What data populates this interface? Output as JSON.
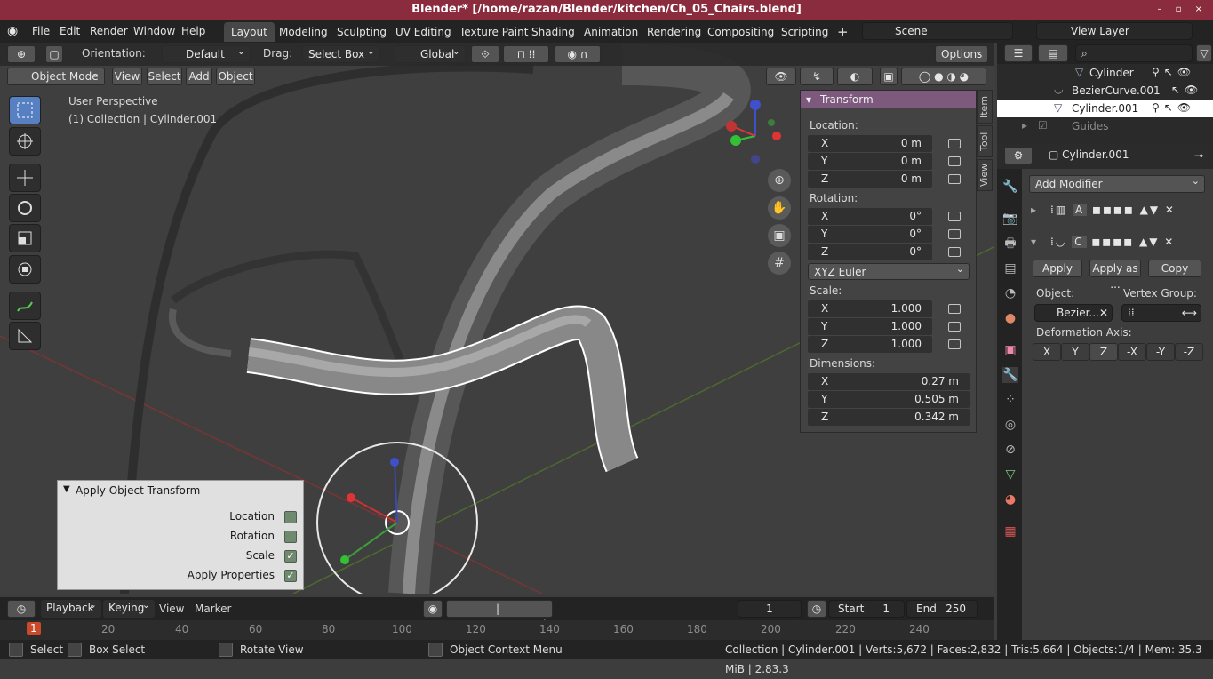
{
  "title": "Blender* [/home/razan/Blender/kitchen/Ch_05_Chairs.blend]",
  "menu": [
    "File",
    "Edit",
    "Render",
    "Window",
    "Help"
  ],
  "workspaces": [
    "Layout",
    "Modeling",
    "Sculpting",
    "UV Editing",
    "Texture Paint",
    "Shading",
    "Animation",
    "Rendering",
    "Compositing",
    "Scripting"
  ],
  "scene": "Scene",
  "viewlayer": "View Layer",
  "header": {
    "orientation_label": "Orientation:",
    "orientation": "Default",
    "drag_label": "Drag:",
    "drag": "Select Box",
    "transform": "Global",
    "options": "Options"
  },
  "vpheader": {
    "mode": "Object Mode",
    "view": "View",
    "select": "Select",
    "add": "Add",
    "object": "Object"
  },
  "overlay": {
    "perspective": "User Perspective",
    "collection": "(1) Collection | Cylinder.001"
  },
  "npanel": {
    "title": "Transform",
    "location": "Location:",
    "rotation": "Rotation:",
    "scale": "Scale:",
    "dimensions": "Dimensions:",
    "loc": [
      "0 m",
      "0 m",
      "0 m"
    ],
    "rot": [
      "0°",
      "0°",
      "0°"
    ],
    "rotmode": "XYZ Euler",
    "scl": [
      "1.000",
      "1.000",
      "1.000"
    ],
    "dim": [
      "0.27 m",
      "0.505 m",
      "0.342 m"
    ],
    "axes": [
      "X",
      "Y",
      "Z"
    ]
  },
  "vtabs": [
    "Item",
    "Tool",
    "View"
  ],
  "apply": {
    "title": "Apply Object Transform",
    "location": "Location",
    "rotation": "Rotation",
    "scale": "Scale",
    "props": "Apply Properties",
    "states": [
      false,
      false,
      true,
      true
    ]
  },
  "outliner": {
    "items": [
      "Cylinder",
      "BezierCurve.001",
      "Cylinder.001",
      "Guides"
    ]
  },
  "props": {
    "object": "Cylinder.001",
    "add_modifier": "Add Modifier",
    "apply": "Apply",
    "apply_as": "Apply as ...",
    "copy": "Copy",
    "object_label": "Object:",
    "vgroup_label": "Vertex Group:",
    "object_value": "Bezier...",
    "deform": "Deformation Axis:",
    "axes": [
      "X",
      "Y",
      "Z",
      "-X",
      "-Y",
      "-Z"
    ]
  },
  "timeline": {
    "playback": "Playback",
    "keying": "Keying",
    "view": "View",
    "marker": "Marker",
    "frame": "1",
    "start_label": "Start",
    "start": "1",
    "end_label": "End",
    "end": "250",
    "ticks": [
      "20",
      "40",
      "60",
      "80",
      "100",
      "120",
      "140",
      "160",
      "180",
      "200",
      "220",
      "240"
    ],
    "current": "1"
  },
  "status": {
    "select": "Select",
    "boxselect": "Box Select",
    "rotate": "Rotate View",
    "context": "Object Context Menu",
    "info": "Collection | Cylinder.001 | Verts:5,672 | Faces:2,832 | Tris:5,664 | Objects:1/4 | Mem: 35.3 MiB | 2.83.3"
  }
}
